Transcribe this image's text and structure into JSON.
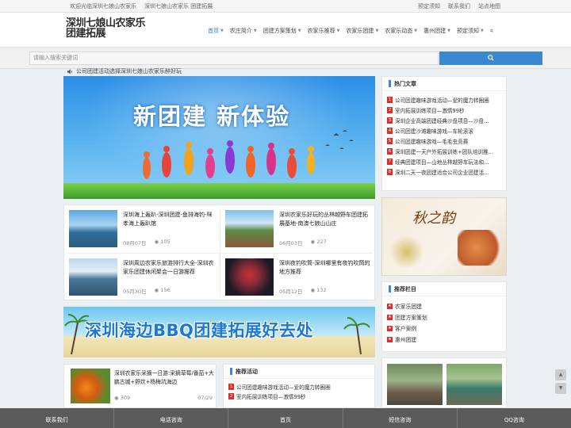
{
  "topbar": {
    "welcome": "欢迎光临深圳七娘山农家乐",
    "link": "深圳七娘山农家乐 团建拓展",
    "right": [
      "预定须知",
      "联系我们",
      "站点地图"
    ]
  },
  "logo": {
    "line1": "深圳七娘山农家乐",
    "line2": "团建拓展"
  },
  "nav": [
    {
      "label": "首页",
      "caret": true,
      "active": true
    },
    {
      "label": "农庄简介",
      "caret": true
    },
    {
      "label": "团建方案策划",
      "caret": true
    },
    {
      "label": "农家乐推荐",
      "caret": true
    },
    {
      "label": "农家乐团建",
      "caret": true
    },
    {
      "label": "农家乐动态",
      "caret": true
    },
    {
      "label": "惠州团建",
      "caret": true
    },
    {
      "label": "预定须知",
      "caret": true
    }
  ],
  "search": {
    "placeholder": "请输入搜索关键词"
  },
  "notice": "公司团建活动选择深圳七娘山农家乐醉好玩",
  "banner": {
    "title": "新团建 新体验"
  },
  "articles": [
    {
      "title": "深圳海上轰趴-深圳团建-鱼排海钓-咪孝海上轰趴馆",
      "date": "08月07日",
      "views": "105"
    },
    {
      "title": "深圳农家乐好玩的丛林越野车团建拓展基地-南澳七娘山山庄",
      "date": "06月03日",
      "views": "227"
    },
    {
      "title": "深圳周边农家乐旅游排行大全-深圳农家乐团建休闲聚会一日游推荐",
      "date": "05月30日",
      "views": "156"
    },
    {
      "title": "深圳夜钓吹筒-深圳哪里有夜钓吹筒的地方推荐",
      "date": "05月12日",
      "views": "132"
    }
  ],
  "banner2": {
    "title": "深圳海边BBQ团建拓展好去处"
  },
  "single": {
    "title": "深圳农家乐采摘一日游:采摘草莓/番茄+大鹏古城+野炊+杨梅坑海边",
    "views": "309",
    "date": "07/29"
  },
  "recommend_activity": {
    "heading": "推荐活动",
    "items": [
      {
        "n": "1",
        "text": "公司团建趣味游戏活动—爱的魔力转圈圈"
      },
      {
        "n": "2",
        "text": "室内拓展训练项目—激情99秒"
      }
    ]
  },
  "hot": {
    "heading": "热门文章",
    "items": [
      {
        "n": "1",
        "text": "公司团建趣味游戏活动—爱的魔力转圈圈"
      },
      {
        "n": "2",
        "text": "室内拓展训练项目—激情99秒"
      },
      {
        "n": "3",
        "text": "深圳企业高端团建经典沙盘项目—沙盘…"
      },
      {
        "n": "4",
        "text": "公司团建沙滩趣味游戏—车轮滚滚"
      },
      {
        "n": "5",
        "text": "公司团建趣味游戏—毛毛虫竞赛"
      },
      {
        "n": "6",
        "text": "深圳团建一天户外拓展训练+团队培训推…"
      },
      {
        "n": "7",
        "text": "经典团建项目—山地丛林越野车玩法和…"
      },
      {
        "n": "8",
        "text": "深圳二天一夜团建适合公司企业团建活…"
      }
    ]
  },
  "ad": {
    "text": "秋之韵"
  },
  "recommend_column": {
    "heading": "推荐栏目",
    "items": [
      "农家乐团建",
      "团建方案策划",
      "客户案例",
      "惠州团建"
    ]
  },
  "bottom": [
    "联系我们",
    "电话咨询",
    "首页",
    "短信咨询",
    "QQ咨询"
  ],
  "colors": {
    "accent": "#3c87d1",
    "rank": "#d9302b",
    "bottombar": "#5b5b5b"
  }
}
